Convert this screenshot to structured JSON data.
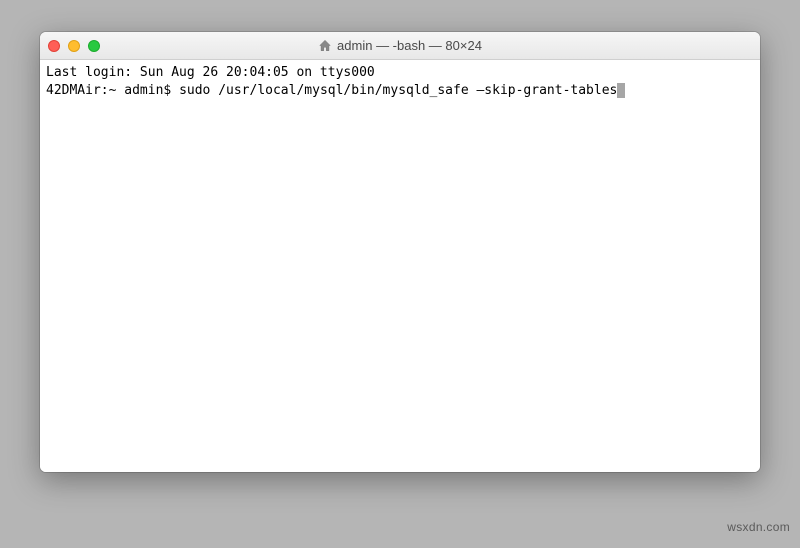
{
  "window": {
    "title": "admin — -bash — 80×24"
  },
  "terminal": {
    "last_login_line": "Last login: Sun Aug 26 20:04:05 on ttys000",
    "host_prefix": "42DMAir:~ admin$",
    "command": "sudo /usr/local/mysql/bin/mysqld_safe –skip-grant-tables"
  },
  "watermark": "wsxdn.com"
}
